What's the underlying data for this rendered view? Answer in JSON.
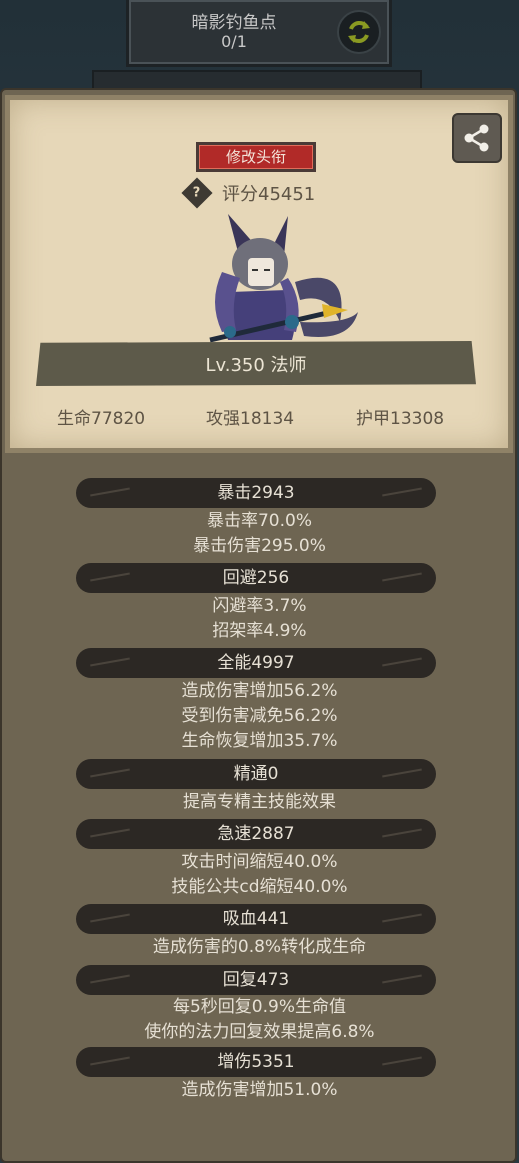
{
  "quest": {
    "title": "暗影钓鱼点",
    "progress": "0/1"
  },
  "card": {
    "change_title_label": "修改头衔",
    "help_mark": "?",
    "score": "评分45451",
    "level_class": "Lv.350 法师",
    "hp": "生命77820",
    "attack": "攻强18134",
    "armor": "护甲13308"
  },
  "attributes": [
    {
      "header": "暴击2943",
      "lines": [
        "暴击率70.0%",
        "暴击伤害295.0%"
      ]
    },
    {
      "header": "回避256",
      "lines": [
        "闪避率3.7%",
        "招架率4.9%"
      ]
    },
    {
      "header": "全能4997",
      "lines": [
        "造成伤害增加56.2%",
        "受到伤害减免56.2%",
        "生命恢复增加35.7%"
      ]
    },
    {
      "header": "精通0",
      "lines": [
        "提高专精主技能效果"
      ]
    },
    {
      "header": "急速2887",
      "lines": [
        "攻击时间缩短40.0%",
        "技能公共cd缩短40.0%"
      ]
    },
    {
      "header": "吸血441",
      "lines": [
        "造成伤害的0.8%转化成生命"
      ]
    },
    {
      "header": "回复473",
      "lines": [
        "每5秒回复0.9%生命值",
        "使你的法力回复效果提高6.8%"
      ]
    },
    {
      "header": "增伤5351",
      "lines": [
        "造成伤害增加51.0%"
      ]
    }
  ],
  "icons": {
    "refresh": "refresh-icon",
    "share": "share-icon",
    "help": "help-icon",
    "avatar": "character-avatar"
  },
  "colors": {
    "title_button": "#b12a28",
    "card_bg": "#e6d7b8",
    "panel_bg": "#6e6552",
    "header_bg": "#2c2824"
  }
}
